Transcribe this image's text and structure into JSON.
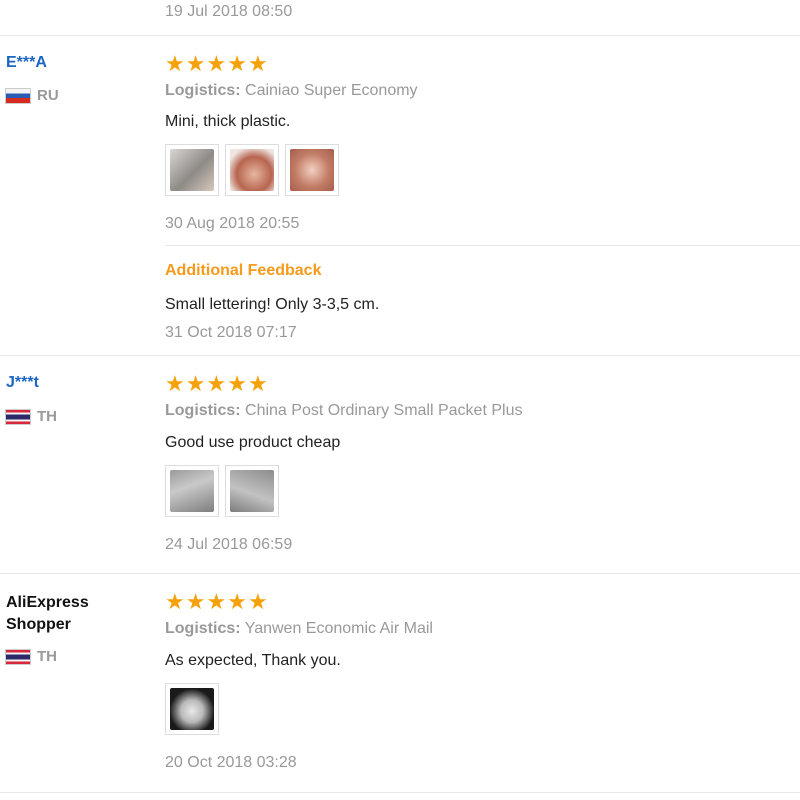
{
  "top": {
    "date": "19 Jul 2018 08:50"
  },
  "reviews": [
    {
      "user": "E***A",
      "country": "RU",
      "flag": "russia-flag-icon",
      "stars": 5,
      "logistics_label": "Logistics:",
      "logistics": "Cainiao Super Economy",
      "text": "Mini, thick plastic.",
      "photos": [
        "photo-1",
        "photo-2",
        "photo-3"
      ],
      "date": "30 Aug 2018 20:55",
      "additional": {
        "title": "Additional Feedback",
        "text": "Small lettering! Only 3-3,5 cm.",
        "date": "31 Oct 2018 07:17"
      }
    },
    {
      "user": "J***t",
      "country": "TH",
      "flag": "thailand-flag-icon",
      "stars": 5,
      "logistics_label": "Logistics:",
      "logistics": "China Post Ordinary Small Packet Plus",
      "text": "Good use product cheap",
      "photos": [
        "photo-1",
        "photo-2"
      ],
      "date": "24 Jul 2018 06:59"
    },
    {
      "user": "AliExpress Shopper",
      "country": "TH",
      "flag": "thailand-flag-icon",
      "stars": 5,
      "logistics_label": "Logistics:",
      "logistics": "Yanwen Economic Air Mail",
      "text": "As expected, Thank you.",
      "photos": [
        "photo-1"
      ],
      "date": "20 Oct 2018 03:28"
    }
  ],
  "star_glyph": "★",
  "colors": {
    "star": "#f5a20a",
    "username": "#1a66c2",
    "additional": "#f59a1b",
    "muted": "#999999"
  }
}
